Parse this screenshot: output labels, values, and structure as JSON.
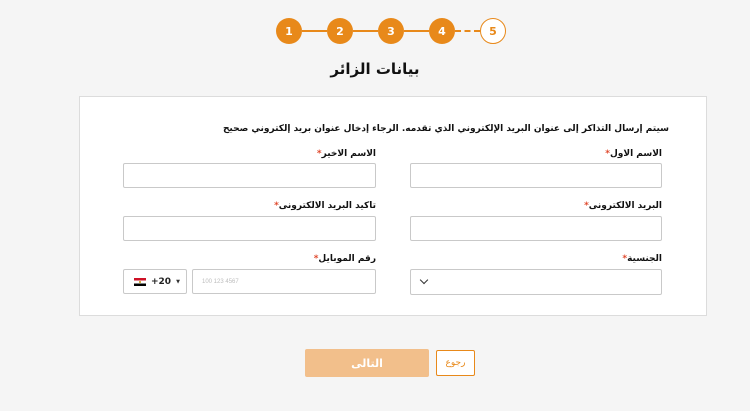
{
  "stepper": {
    "steps": [
      {
        "number": "1",
        "state": "done"
      },
      {
        "number": "2",
        "state": "done"
      },
      {
        "number": "3",
        "state": "done"
      },
      {
        "number": "4",
        "state": "done"
      },
      {
        "number": "5",
        "state": "current"
      }
    ]
  },
  "page": {
    "title": "بيانات الزائر",
    "intro": "سيتم إرسال التذاكر إلى عنوان البريد الإلكتروني الذي تقدمه. الرجاء إدخال عنوان بريد إلكتروني صحيح"
  },
  "form": {
    "first_name_label": "الاسم الاول",
    "last_name_label": "الاسم الاخير",
    "email_label": "البريد الالكترونى",
    "confirm_email_label": "تاكيد البريد الالكترونى",
    "nationality_label": "الجنسية",
    "mobile_label": "رقم الموبايل",
    "required_mark": "*",
    "country_code": "+20",
    "country_code_caret": "▼",
    "mobile_placeholder": "100 123 4567"
  },
  "buttons": {
    "next_label": "التالى",
    "back_label": "رجوع"
  },
  "colors": {
    "accent": "#e8891a",
    "accent_disabled": "#f2bf8b",
    "required": "#e0492d"
  },
  "icons": {
    "flag": "egypt-flag-icon",
    "select": "chevron-down-icon"
  }
}
